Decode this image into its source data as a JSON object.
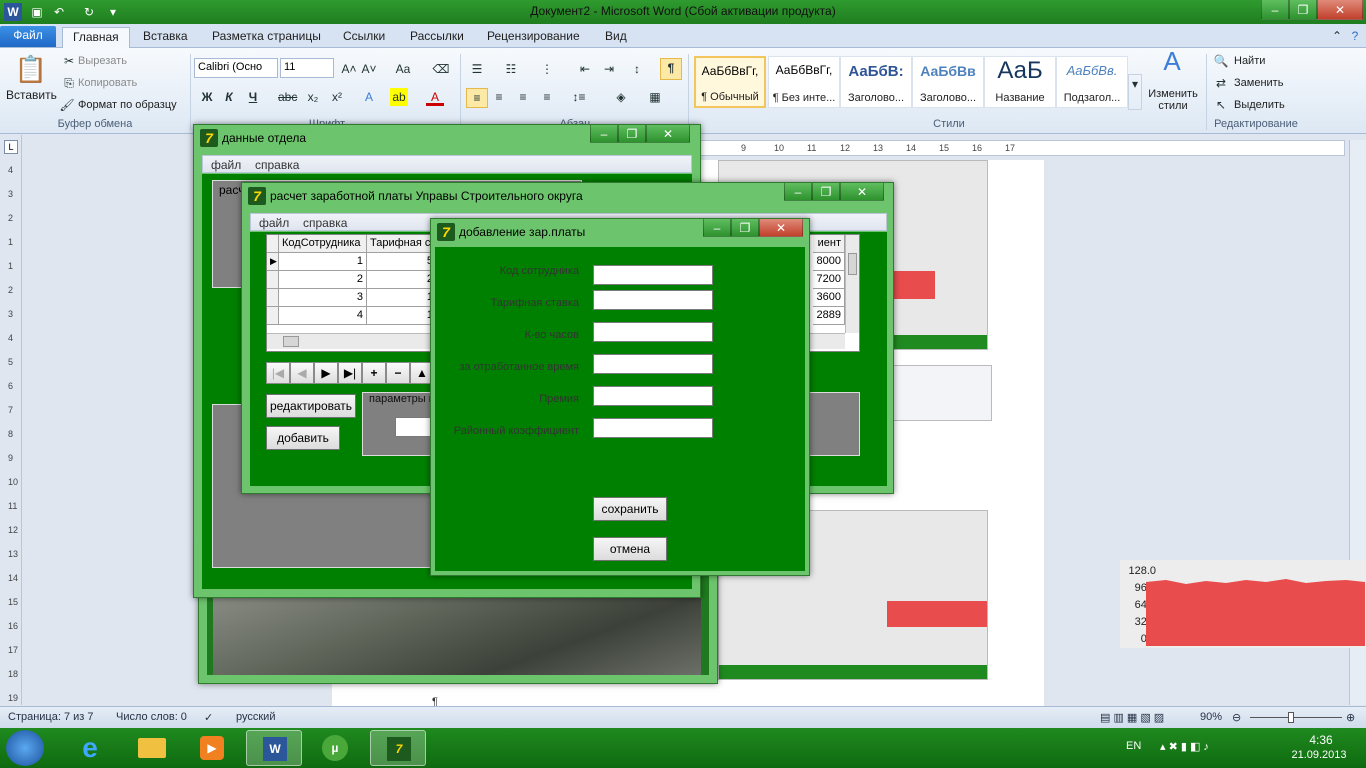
{
  "word": {
    "window_title": "Документ2  -  Microsoft Word (Сбой активации продукта)",
    "tabs": [
      "Файл",
      "Главная",
      "Вставка",
      "Разметка страницы",
      "Ссылки",
      "Рассылки",
      "Рецензирование",
      "Вид"
    ],
    "active_tab": "Главная",
    "clipboard": {
      "paste": "Вставить",
      "cut": "Вырезать",
      "copy": "Копировать",
      "format_painter": "Формат по образцу",
      "group_label": "Буфер обмена"
    },
    "font": {
      "name": "Calibri (Осно",
      "size": "11",
      "group_label": "Шрифт"
    },
    "paragraph": {
      "group_label": "Абзац"
    },
    "styles": {
      "items": [
        {
          "sample": "АаБбВвГг,",
          "name": "¶ Обычный"
        },
        {
          "sample": "АаБбВвГг,",
          "name": "¶ Без инте..."
        },
        {
          "sample": "АаБбВ:",
          "name": "Заголово..."
        },
        {
          "sample": "АаБбВв",
          "name": "Заголово..."
        },
        {
          "sample": "АаБ",
          "name": "Название"
        },
        {
          "sample": "АаБбВв.",
          "name": "Подзагол..."
        }
      ],
      "change_styles": "Изменить стили",
      "group_label": "Стили"
    },
    "editing": {
      "find": "Найти",
      "replace": "Заменить",
      "select": "Выделить",
      "group_label": "Редактирование"
    },
    "status": {
      "page": "Страница: 7 из 7",
      "words": "Число слов: 0",
      "language": "русский",
      "zoom": "90%"
    }
  },
  "ruler_top": [
    "9",
    "10",
    "11",
    "12",
    "13",
    "14",
    "15",
    "16",
    "17"
  ],
  "ruler_left": [
    "4",
    "3",
    "2",
    "1",
    "1",
    "2",
    "3",
    "4",
    "5",
    "6",
    "7",
    "8",
    "9",
    "10",
    "11",
    "12",
    "13",
    "14",
    "15",
    "16",
    "17",
    "18",
    "19"
  ],
  "taskbar": {
    "lang": "EN",
    "time": "4:36",
    "date": "21.09.2013"
  },
  "win_dept": {
    "title": "данные отдела",
    "menu": [
      "файл",
      "справка"
    ],
    "partial_label": "расч"
  },
  "win_salary": {
    "title": "расчет заработной платы Управы Строительного округа",
    "menu": [
      "файл",
      "справка"
    ],
    "grid": {
      "columns": [
        "КодСотрудника",
        "Тарифная ст",
        "иент"
      ],
      "rows": [
        [
          "1",
          "5",
          "8000"
        ],
        [
          "2",
          "2",
          "7200"
        ],
        [
          "3",
          "1",
          "3600"
        ],
        [
          "4",
          "1",
          "2889"
        ]
      ]
    },
    "edit_button": "редактировать",
    "add_button": "добавить",
    "params_label": "параметры п"
  },
  "win_add": {
    "title": "добавление зар.платы",
    "fields": [
      {
        "label": "Код сотрудника",
        "value": ""
      },
      {
        "label": "Тарифная ставка",
        "value": ""
      },
      {
        "label": "К-во часов",
        "value": ""
      },
      {
        "label": "за отработанное время",
        "value": ""
      },
      {
        "label": "Премия",
        "value": ""
      },
      {
        "label": "Районный коэффициент",
        "value": ""
      }
    ],
    "save_button": "сохранить",
    "cancel_button": "отмена"
  },
  "monitor": {
    "axis": [
      "128.0",
      "96.0",
      "64.0",
      "32.0",
      "0.0"
    ],
    "fill_color": "#e84c4c"
  }
}
